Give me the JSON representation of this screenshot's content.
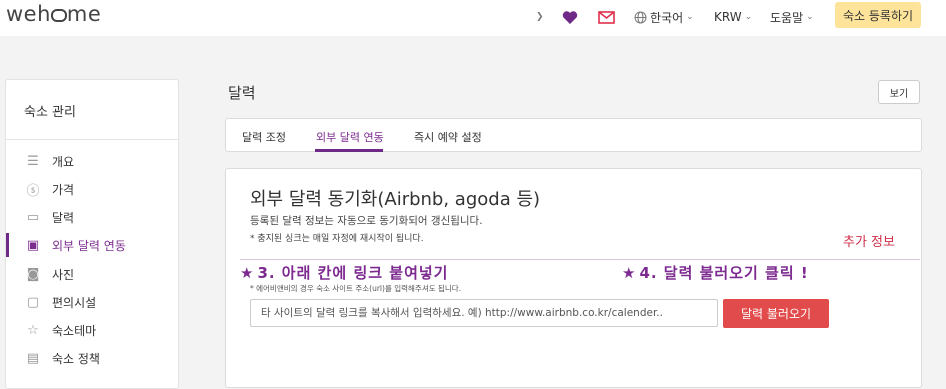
{
  "header": {
    "logo": "weh me",
    "language": "한국어",
    "currency": "KRW",
    "help": "도움말",
    "cta": "숙소 등록하기",
    "accent": "#6e2a86",
    "cta_color": "#fde49a"
  },
  "sidebar": {
    "title": "숙소 관리",
    "items": [
      {
        "label": "개요",
        "icon": "menu-icon"
      },
      {
        "label": "가격",
        "icon": "dollar-icon"
      },
      {
        "label": "달력",
        "icon": "calendar-icon"
      },
      {
        "label": "외부 달력 연동",
        "icon": "calendar-sync-icon",
        "active": true
      },
      {
        "label": "사진",
        "icon": "camera-icon"
      },
      {
        "label": "편의시설",
        "icon": "tv-icon"
      },
      {
        "label": "숙소테마",
        "icon": "star-icon"
      },
      {
        "label": "숙소 정책",
        "icon": "document-icon"
      }
    ]
  },
  "main": {
    "title": "달력",
    "view_button": "보기",
    "tabs": [
      "달력 조정",
      "외부 달력 연동",
      "즉시 예약 설정"
    ],
    "active_tab": 1
  },
  "card": {
    "title": "외부 달력 동기화(Airbnb, agoda 등)",
    "desc1": "등록된 달력 정보는 자동으로 동기화되어 갱신됩니다.",
    "desc2": "* 충지된 싱크는 매일 자정에 재시작이 됩니다.",
    "more_info": "추가 정보",
    "hint": "* 에어비앤비의 경우 숙소 사이트 주소(url)를 입력해주셔도 됩니다.",
    "input_placeholder": "타 사이트의 달력 링크를 복사해서 입력하세요. 예) http://www.airbnb.co.kr/calender..",
    "load_button": "달력 불러오기",
    "button_color": "#e24b4b"
  },
  "annotations": {
    "step3": "3. 아래 칸에 링크 붙여넣기",
    "step4": "4. 달력 불러오기 클릭 !",
    "star": "★"
  }
}
